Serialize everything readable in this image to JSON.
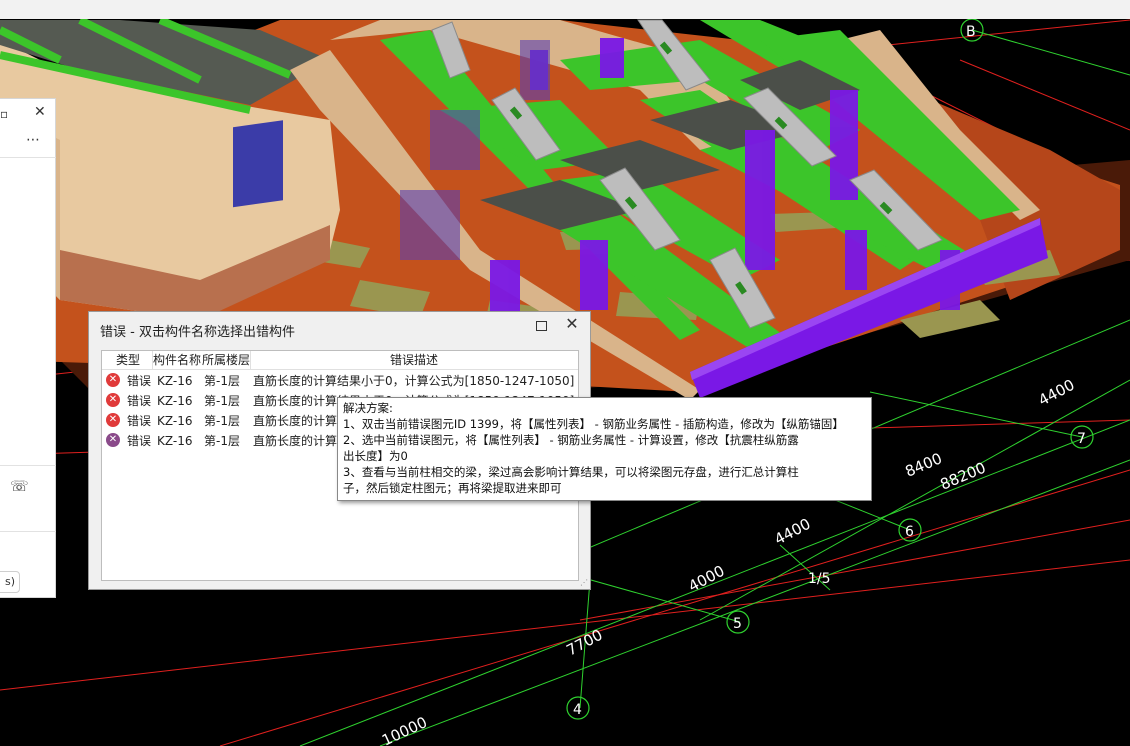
{
  "viewport": {
    "axis_labels": {
      "b": "B",
      "seven": "7",
      "six": "6",
      "five": "5",
      "four": "4",
      "one_slash_five": "1/5"
    },
    "dimensions": {
      "d4400_a": "4400",
      "d8400": "8400",
      "d88200": "88200",
      "d4400_b": "4400",
      "d4000": "4000",
      "d7700": "7700",
      "d10000": "10000"
    }
  },
  "side_panel": {
    "chip_text": "s)"
  },
  "error_dialog": {
    "title": "错误 - 双击构件名称选择出错构件",
    "columns": {
      "type": "类型",
      "name": "构件名称",
      "floor": "所属楼层",
      "desc": "错误描述"
    },
    "rows": [
      {
        "type": "错误",
        "name": "KZ-16",
        "floor": "第-1层",
        "desc": "直筋长度的计算结果小于0，计算公式为[1850-1247-1050]",
        "status": "error"
      },
      {
        "type": "错误",
        "name": "KZ-16",
        "floor": "第-1层",
        "desc": "直筋长度的计算结果小于0，计算公式为[1850-1247-1050]",
        "status": "error"
      },
      {
        "type": "错误",
        "name": "KZ-16",
        "floor": "第-1层",
        "desc": "直筋长度的计算",
        "status": "error"
      },
      {
        "type": "错误",
        "name": "KZ-16",
        "floor": "第-1层",
        "desc": "直筋长度的计算",
        "status": "selected"
      }
    ]
  },
  "tooltip": {
    "lines": [
      "解决方案:",
      "1、双击当前错误图元ID 1399，将【属性列表】 - 钢筋业务属性 - 插筋构造，修改为【纵筋锚固】",
      "2、选中当前错误图元，将【属性列表】 - 钢筋业务属性 - 计算设置，修改【抗震柱纵筋露",
      "出长度】为0",
      "3、查看与当前柱相交的梁，梁过高会影响计算结果，可以将梁图元存盘，进行汇总计算柱",
      "子，然后锁定柱图元；再将梁提取进来即可"
    ]
  },
  "colors": {
    "grid_red": "#e0201e",
    "grid_green": "#2fd12f",
    "beam_green": "#3cc52a",
    "slab_orange": "#c4521c",
    "column_purple": "#7a18e6",
    "error_red": "#e03a3a",
    "selected_purple": "#8a4a8a"
  }
}
